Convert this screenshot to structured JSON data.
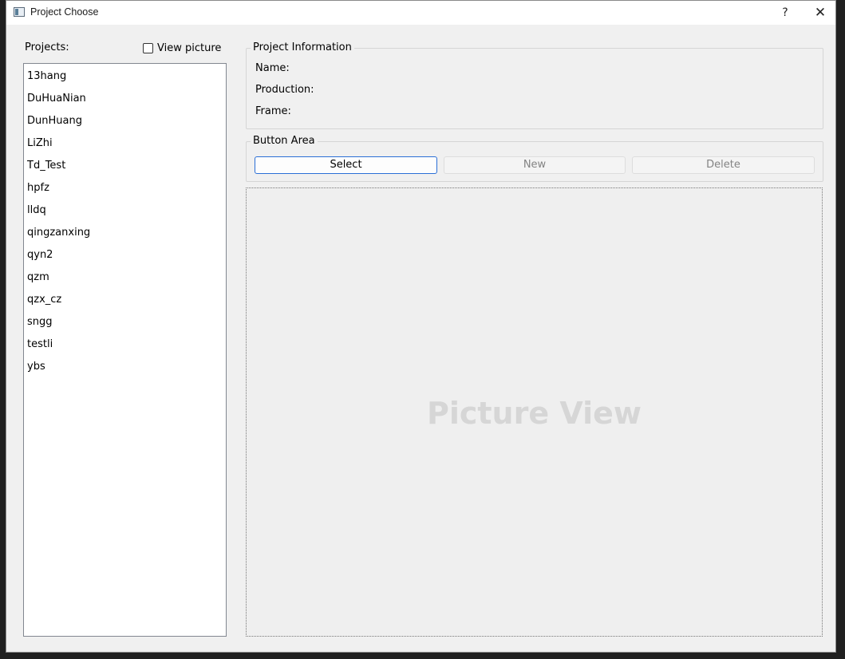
{
  "window": {
    "title": "Project Choose",
    "help_label": "?",
    "close_label": "✕"
  },
  "left": {
    "projects_label": "Projects:",
    "view_picture_label": "View picture",
    "view_picture_checked": false,
    "projects": [
      "13hang",
      "DuHuaNian",
      "DunHuang",
      "LiZhi",
      "Td_Test",
      "hpfz",
      "lldq",
      "qingzanxing",
      "qyn2",
      "qzm",
      "qzx_cz",
      "sngg",
      "testli",
      "ybs"
    ]
  },
  "info": {
    "group_title": "Project Information",
    "name_label": "Name:",
    "production_label": "Production:",
    "frame_label": "Frame:"
  },
  "buttons": {
    "group_title": "Button Area",
    "select_label": "Select",
    "new_label": "New",
    "delete_label": "Delete"
  },
  "picture": {
    "placeholder": "Picture View"
  },
  "colors": {
    "window_bg": "#f0f0f0",
    "accent": "#2b6fd6",
    "disabled_text": "#838383"
  }
}
